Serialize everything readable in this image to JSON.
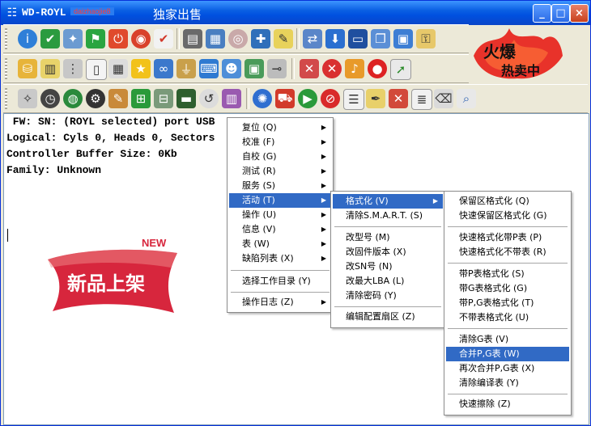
{
  "window": {
    "title_left": "WD-ROYL",
    "title_watermark": "daizhaojie8",
    "title_right": "独家出售",
    "controls": [
      "_",
      "□",
      "×"
    ]
  },
  "promo": {
    "new_label": "NEW",
    "text": "新品上架"
  },
  "hot_badge": {
    "line1": "火爆",
    "line2": "热卖中"
  },
  "console": [
    " FW: SN: (ROYL selected) port USB",
    "Logical: Cyls 0, Heads 0, Sectors",
    "Controller Buffer Size: 0Kb",
    "Family: Unknown"
  ],
  "menu1": [
    {
      "label": "复位 (Q)",
      "arrow": "▶"
    },
    {
      "label": "校准 (F)",
      "arrow": "▶"
    },
    {
      "label": "自校 (G)",
      "arrow": "▶"
    },
    {
      "label": "测试 (R)",
      "arrow": "▶"
    },
    {
      "label": "服务 (S)",
      "arrow": "▶"
    },
    {
      "label": "活动 (T)",
      "arrow": "▶"
    },
    {
      "label": "操作 (U)",
      "arrow": "▶"
    },
    {
      "label": "信息 (V)",
      "arrow": "▶"
    },
    {
      "label": "表 (W)",
      "arrow": "▶"
    },
    {
      "label": "缺陷列表 (X)",
      "arrow": "▶"
    },
    {
      "label": "选择工作目录 (Y)",
      "arrow": ""
    },
    {
      "label": "操作日志 (Z)",
      "arrow": "▶"
    }
  ],
  "menu2": [
    {
      "label": "格式化 (V)",
      "arrow": "▶"
    },
    {
      "label": "清除S.M.A.R.T. (S)",
      "arrow": ""
    },
    {
      "label": "改型号 (M)",
      "arrow": ""
    },
    {
      "label": "改固件版本 (X)",
      "arrow": ""
    },
    {
      "label": "改SN号 (N)",
      "arrow": ""
    },
    {
      "label": "改最大LBA (L)",
      "arrow": ""
    },
    {
      "label": "清除密码 (Y)",
      "arrow": ""
    },
    {
      "label": "编辑配置扇区 (Z)",
      "arrow": ""
    }
  ],
  "menu3": [
    {
      "label": "保留区格式化 (Q)"
    },
    {
      "label": "快速保留区格式化 (G)"
    },
    {
      "label": "快速格式化带P表 (P)"
    },
    {
      "label": "快速格式化不带表 (R)"
    },
    {
      "label": "带P表格式化 (S)"
    },
    {
      "label": "带G表格式化 (G)"
    },
    {
      "label": "带P,G表格式化 (T)"
    },
    {
      "label": "不带表格式化 (U)"
    },
    {
      "label": "清除G表 (V)"
    },
    {
      "label": "合并P,G表 (W)"
    },
    {
      "label": "再次合并P,G表 (X)"
    },
    {
      "label": "清除编译表 (Y)"
    },
    {
      "label": "快速擦除 (Z)"
    }
  ],
  "colors": {
    "title_bar": "#0a5fe3",
    "menu_highlight": "#316ac5",
    "promo_red": "#d7263d"
  }
}
